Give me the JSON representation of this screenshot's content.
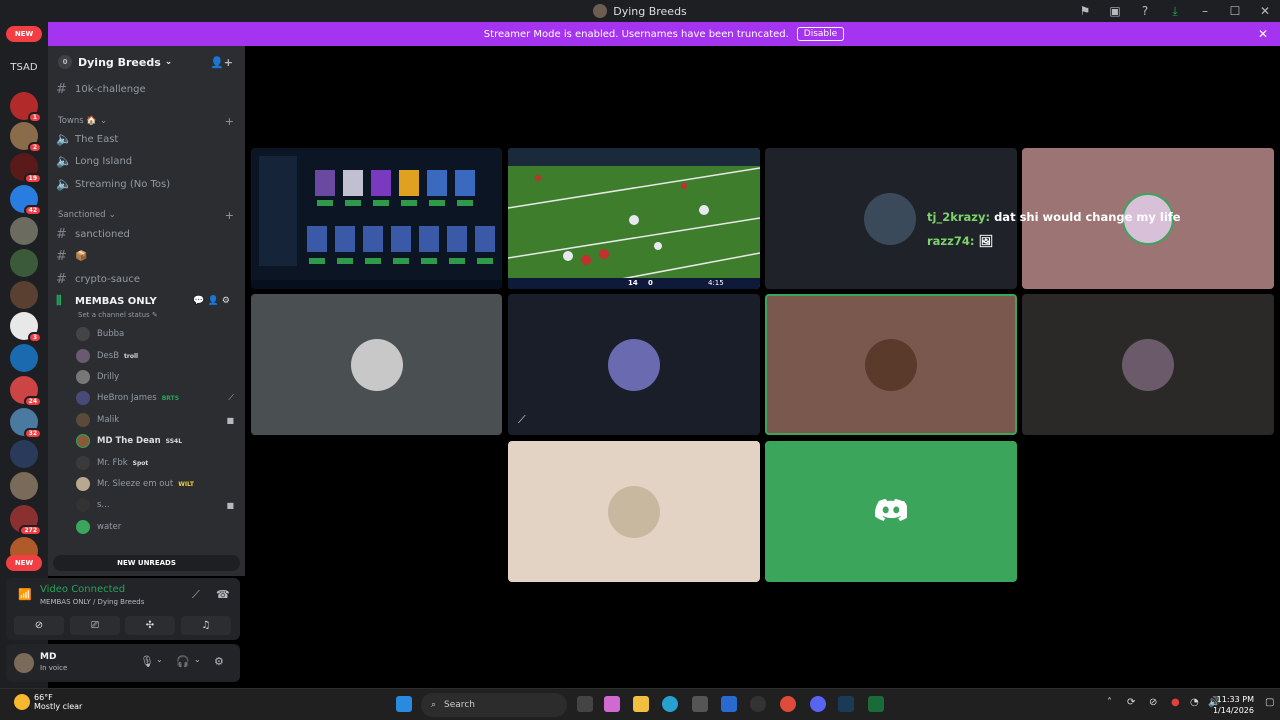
{
  "window": {
    "title": "Dying Breeds"
  },
  "banner": {
    "text": "Streamer Mode is enabled. Usernames have been truncated.",
    "disable_label": "Disable"
  },
  "servers": {
    "new_label": "NEW",
    "home_label": "TSAD",
    "badges": [
      "1",
      "2",
      "19",
      "42",
      "3",
      "24",
      "32",
      "272"
    ]
  },
  "guild": {
    "name": "Dying Breeds",
    "initial": "0"
  },
  "channels": {
    "top": [
      {
        "name": "10k-challenge"
      }
    ],
    "towns_label": "Towns 🏠",
    "towns": [
      {
        "name": "The East"
      },
      {
        "name": "Long Island"
      },
      {
        "name": "Streaming (No Tos)"
      }
    ],
    "sanctioned_label": "Sanctioned",
    "sanctioned": [
      {
        "name": "sanctioned"
      },
      {
        "name": "📦"
      },
      {
        "name": "crypto-sauce"
      }
    ],
    "voice_active": {
      "name": "MEMBAS ONLY",
      "status": "Set a channel status"
    }
  },
  "members": [
    {
      "name": "Bubba",
      "tag": ""
    },
    {
      "name": "DesB",
      "tag": "troll"
    },
    {
      "name": "Drilly",
      "tag": ""
    },
    {
      "name": "HeBron James",
      "tag": "BRTS"
    },
    {
      "name": "Malik",
      "tag": ""
    },
    {
      "name": "MD The Dean",
      "tag": "SS4L"
    },
    {
      "name": "Mr. Fbk",
      "tag": "Spot"
    },
    {
      "name": "Mr. Sleeze em out",
      "tag": "WILT"
    },
    {
      "name": "s...",
      "tag": ""
    },
    {
      "name": "water",
      "tag": ""
    }
  ],
  "new_unreads": "NEW UNREADS",
  "voice_panel": {
    "title": "Video Connected",
    "subtitle": "MEMBAS ONLY / Dying Breeds"
  },
  "user_panel": {
    "name": "MD",
    "status": "In voice"
  },
  "chat_overlay": [
    {
      "name": "tj_2krazy:",
      "message": "dat shi would change my life"
    },
    {
      "name": "razz74:",
      "message": "🖼"
    }
  ],
  "game_hud": {
    "home_score": "14",
    "away_score": "0",
    "clock": "4:15"
  },
  "taskbar": {
    "temperature": "66°F",
    "weather": "Mostly clear",
    "search_placeholder": "Search",
    "time": "11:33 PM",
    "date": "1/14/2026"
  },
  "colors": {
    "accent": "#a534f0",
    "green": "#23a55a",
    "discord_green": "#3ba55c"
  }
}
